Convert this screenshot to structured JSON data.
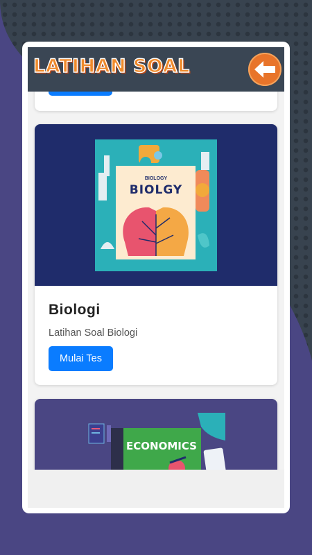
{
  "header": {
    "title": "LATIHAN SOAL",
    "back_icon": "arrow-left-icon"
  },
  "cards": [
    {
      "cover_title_small": "BIOLOGY",
      "cover_title_big": "BIOLGY",
      "title": "Biologi",
      "subtitle": "Latihan Soal Biologi",
      "button_label": "Mulai Tes"
    },
    {
      "cover_title": "ECONOMICS"
    }
  ],
  "colors": {
    "accent": "#0a7cff",
    "background": "#4a4683",
    "header": "#3a4654",
    "logo": "#f08a2a"
  }
}
